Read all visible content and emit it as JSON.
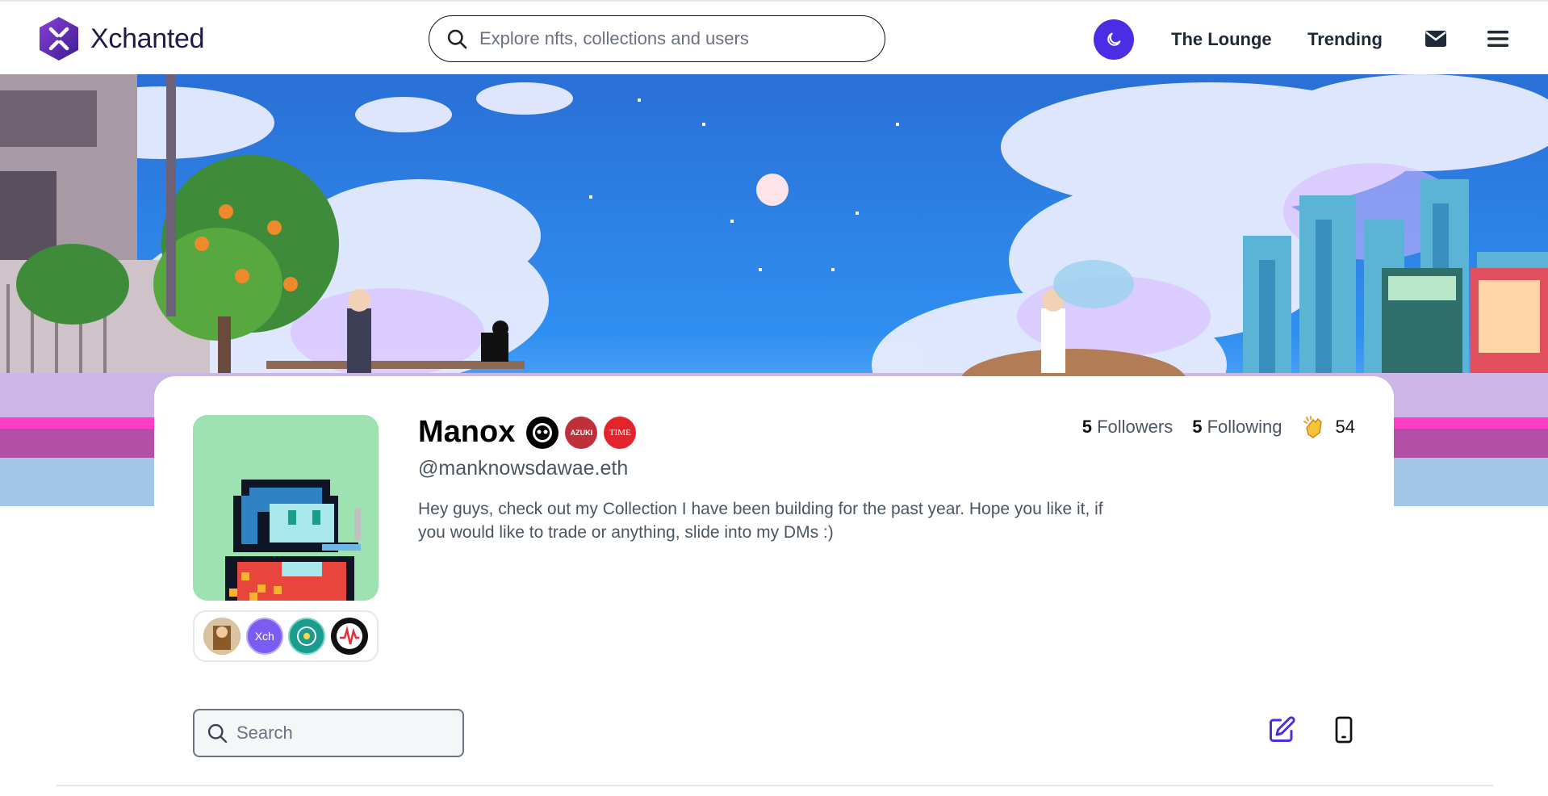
{
  "header": {
    "logo_text": "Xchanted",
    "search_placeholder": "Explore nfts, collections and users",
    "nav": [
      {
        "label": "The Lounge"
      },
      {
        "label": "Trending"
      }
    ],
    "theme_toggle_color": "#4b2ee3"
  },
  "profile": {
    "name": "Manox",
    "handle": "@manknowsdawae.eth",
    "bio": "Hey guys, check out my Collection I have been building for the past year. Hope you like it, if you would like to trade or anything, slide into my DMs :)",
    "verified_badges": [
      {
        "name": "skull-badge",
        "color": "#000000"
      },
      {
        "name": "azuki-badge",
        "label": "AZUKI",
        "color": "#c0303a"
      },
      {
        "name": "time-badge",
        "label": "TIME",
        "color": "#e3242b"
      }
    ],
    "followers_count": "5",
    "followers_label": "Followers",
    "following_count": "5",
    "following_label": "Following",
    "claps": "54",
    "collection_badges": [
      {
        "name": "collection-badge-1"
      },
      {
        "name": "collection-badge-xch",
        "label": "Xch"
      },
      {
        "name": "collection-badge-3"
      },
      {
        "name": "collection-badge-4"
      }
    ]
  },
  "gallery": {
    "search_placeholder": "Search"
  },
  "colors": {
    "accent": "#4b2ee3",
    "avatar_bg": "#9ee2b2"
  }
}
